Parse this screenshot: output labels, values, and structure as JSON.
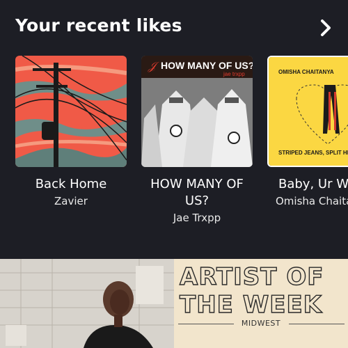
{
  "section": {
    "title": "Your recent likes"
  },
  "cards": [
    {
      "title": "Back Home",
      "artist": "Zavier"
    },
    {
      "title": "HOW MANY OF US?",
      "artist": "Jae Trxpp",
      "cover_text": "HOW MANY OF US?",
      "cover_subtext": "jae trxpp"
    },
    {
      "title": "Baby, Ur Wa",
      "artist": "Omisha Chaita",
      "cover_top": "OMISHA CHAITANYA",
      "cover_bottom": "STRIPED JEANS, SPLIT HE"
    }
  ],
  "promo": {
    "headline_line1": "ARTIST OF",
    "headline_line2": "THE WEEK",
    "region": "MIDWEST"
  },
  "colors": {
    "background": "#1d1e25",
    "cover1_sky": "#f05a47",
    "cover2_banner": "#2a1a14",
    "cover3_bg": "#fbd742",
    "promo_bg": "#f2e5cc"
  }
}
